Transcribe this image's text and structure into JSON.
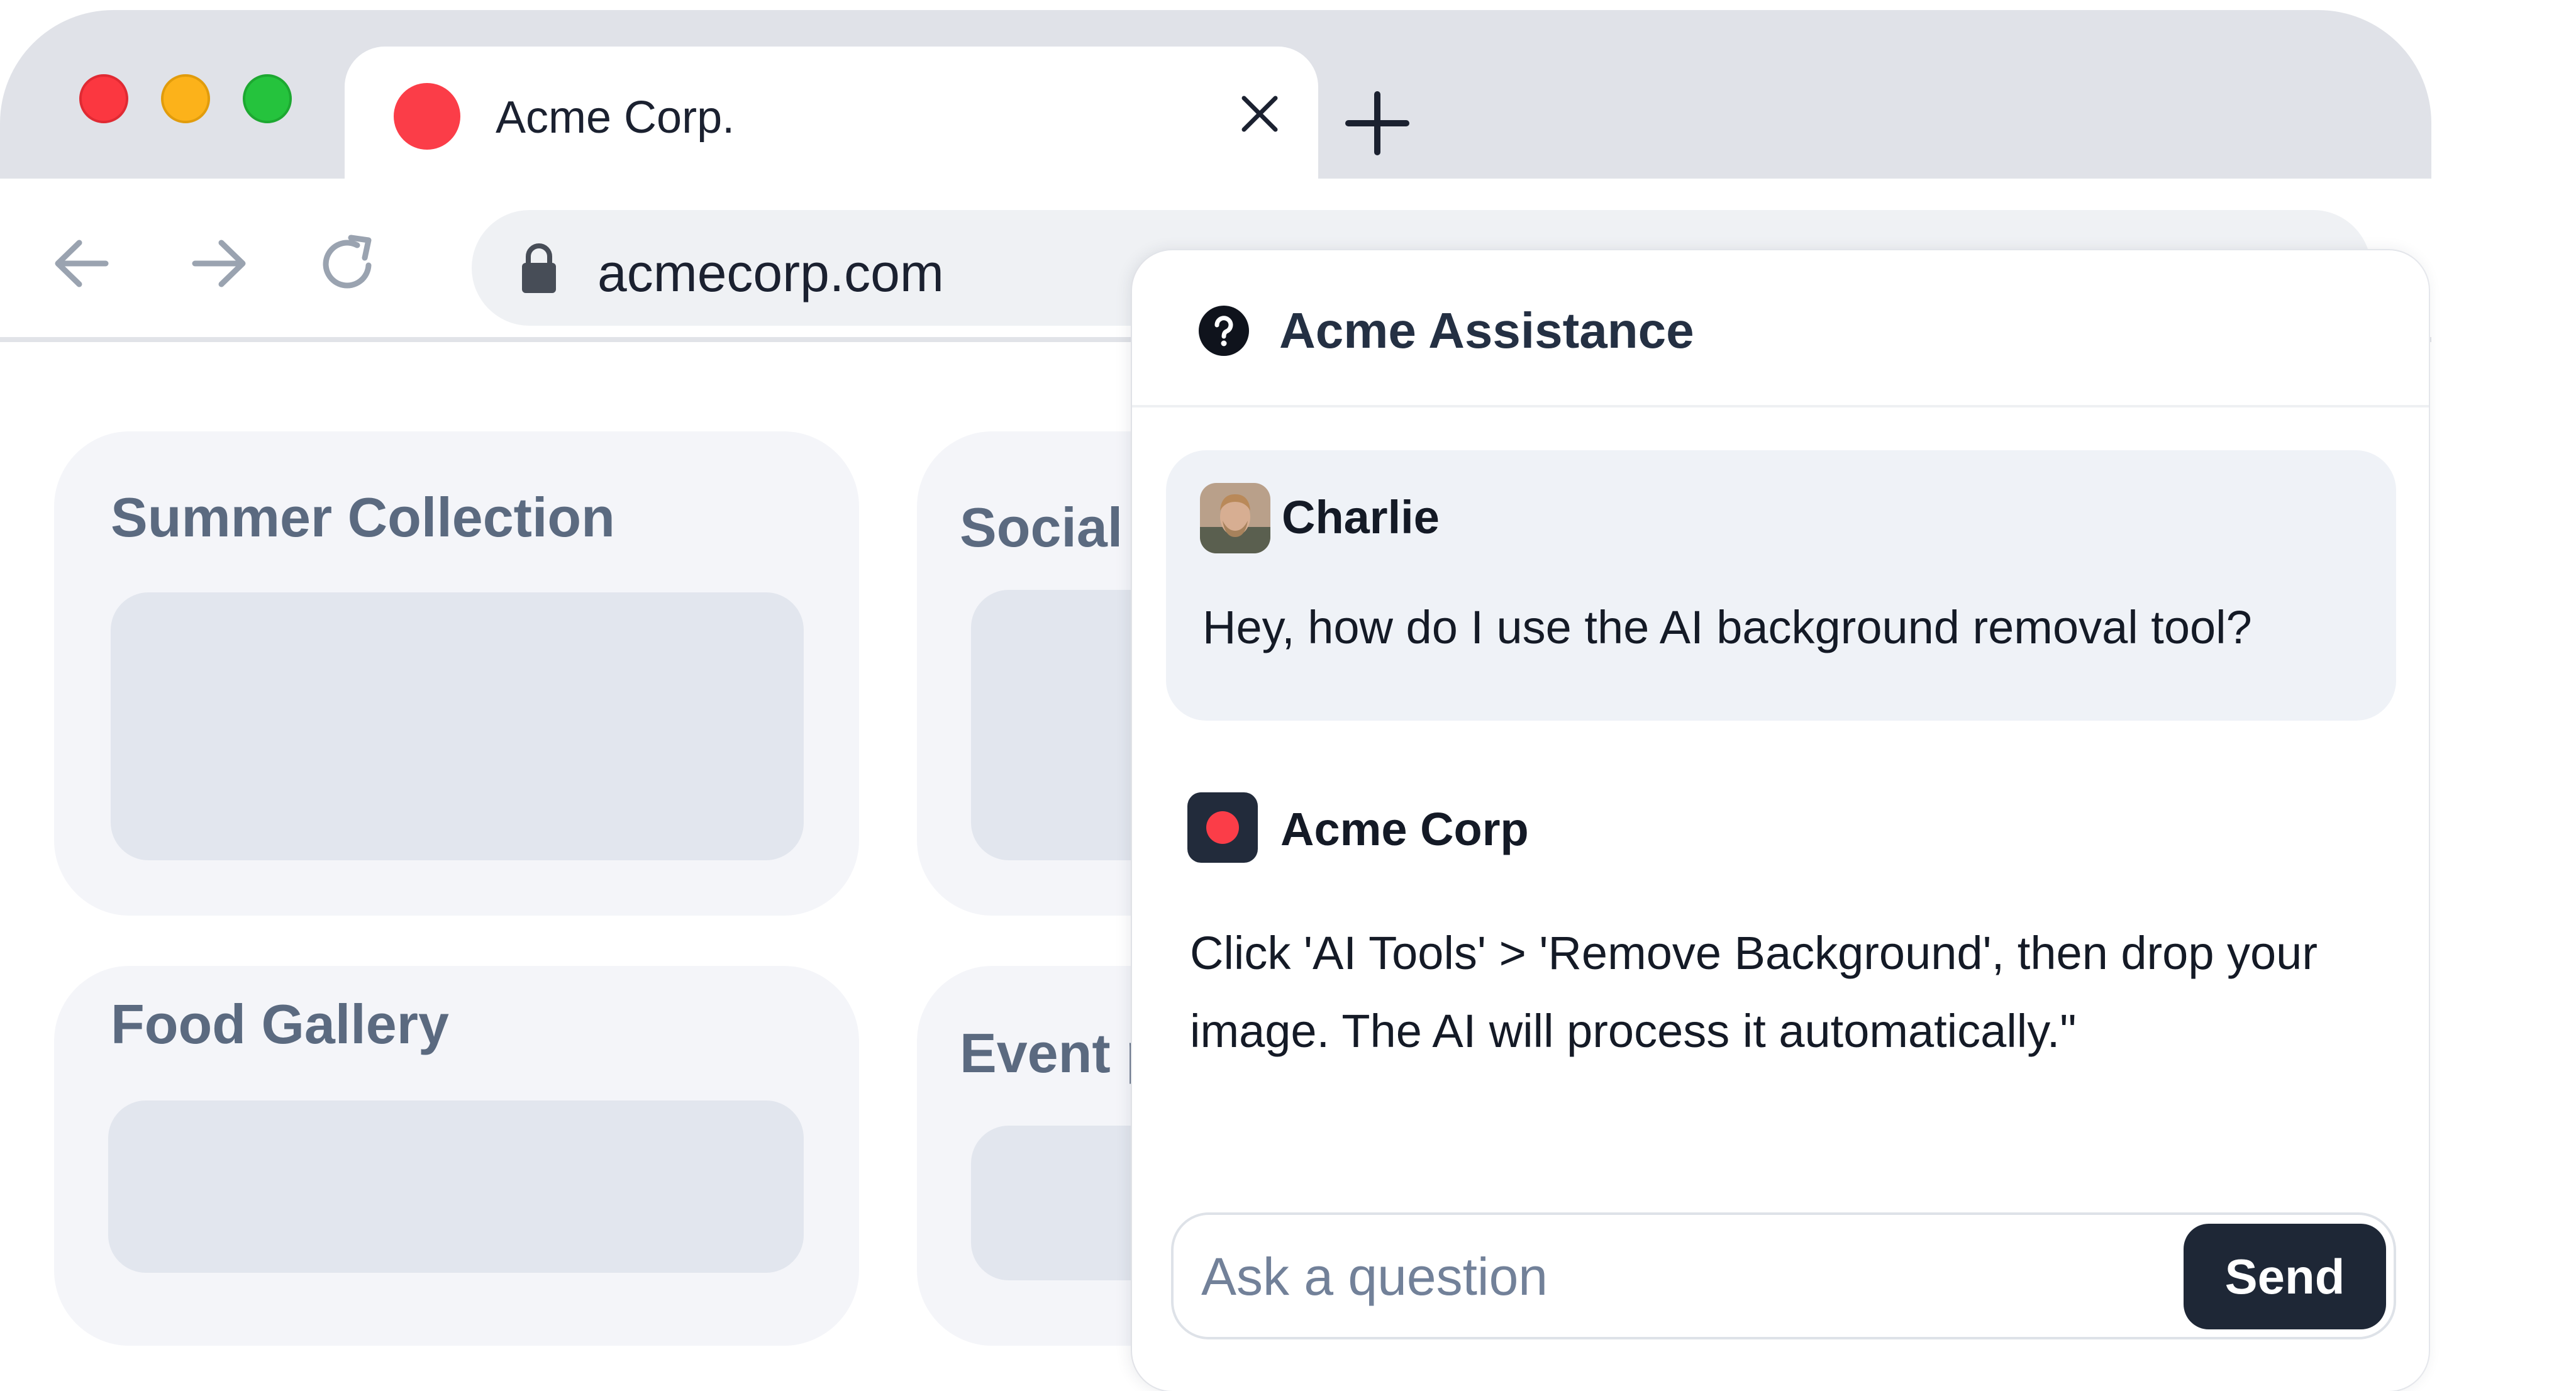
{
  "browser": {
    "tab": {
      "title": "Acme Corp.",
      "favicon_color": "#fb3d48",
      "close_icon": "close-icon"
    },
    "new_tab_icon": "plus-icon",
    "nav": {
      "back_icon": "arrow-left-icon",
      "forward_icon": "arrow-right-icon",
      "reload_icon": "reload-icon"
    },
    "address_bar": {
      "url": "acmecorp.com",
      "lock_icon": "lock-icon"
    },
    "traffic_lights": [
      "#fb3740",
      "#fcb21a",
      "#25c33d"
    ]
  },
  "page": {
    "cards": [
      {
        "title": "Summer Collection"
      },
      {
        "title": "Social I"
      },
      {
        "title": "Food Gallery"
      },
      {
        "title": "Event p"
      }
    ]
  },
  "chat": {
    "header": {
      "title": "Acme Assistance",
      "icon": "help-circle-icon"
    },
    "messages": [
      {
        "sender": "Charlie",
        "text": "Hey, how do I use the AI background removal tool?"
      },
      {
        "sender": "Acme Corp",
        "text": "Click 'AI Tools' > 'Remove Background', then drop your image. The AI will process it automatically.\""
      }
    ],
    "composer": {
      "placeholder": "Ask a question",
      "send_label": "Send"
    },
    "colors": {
      "accent": "#fb3d48",
      "button": "#1e2736",
      "bubble": "#eff2f7"
    }
  }
}
